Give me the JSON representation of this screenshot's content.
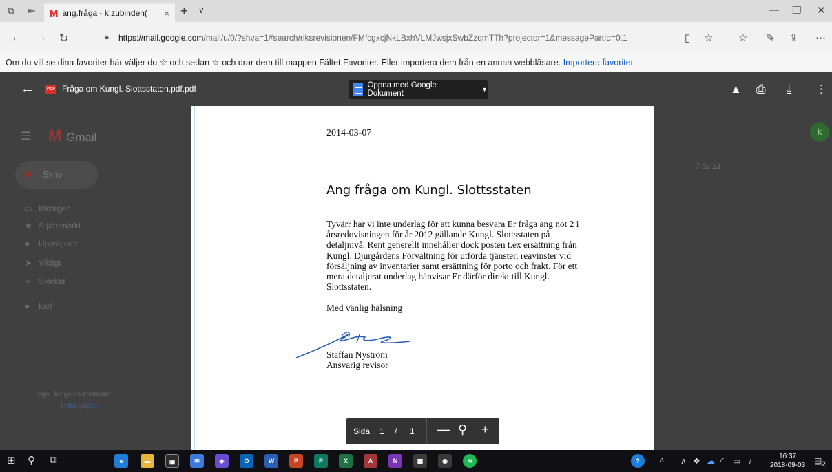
{
  "browser": {
    "tab_title": "ang.fråga - k.zubinden(",
    "tab_close": "×",
    "new_tab": "+",
    "tab_dropdown": "∨",
    "url_host": "https://mail.google.com",
    "url_path": "/mail/u/0/?shva=1#search/riksrevisionen/FMfcgxcjNkLBxhVLMJwsjxSwbZzqmTTh?projector=1&messagePartId=0.1",
    "favorites_message": "Om du vill se dina favoriter här väljer du ☆ och sedan ☆ och drar dem till mappen Fältet Favoriter. Eller importera dem från en annan webbläsare. ",
    "favorites_link": "Importera favoriter"
  },
  "gmail": {
    "logo_text": "Gmail",
    "compose_label": "Skriv",
    "nav_items": [
      {
        "label": "Inkorgen",
        "icon": "inbox-icon"
      },
      {
        "label": "Stjärnmärkt",
        "icon": "star-icon"
      },
      {
        "label": "Uppskjutet",
        "icon": "clock-icon"
      },
      {
        "label": "Viktigt",
        "icon": "important-icon"
      },
      {
        "label": "Skickat",
        "icon": "send-icon"
      }
    ],
    "user_label": "karl",
    "hangouts_note": "Inga Hangouts-kontakter",
    "hangouts_link": "Hitta någon",
    "avatar_letter": "k",
    "pager_text": "7 av 13"
  },
  "viewer": {
    "filename": "Fråga om Kungl. Slottsstaten.pdf.pdf",
    "pdf_badge": "PDF",
    "open_with_label": "Öppna med Google Dokument",
    "page_label": "Sida",
    "current_page": "1",
    "page_sep": "/",
    "total_pages": "1"
  },
  "document": {
    "date": "2014-03-07",
    "heading": "Ang fråga om Kungl. Slottsstaten",
    "body_lines": [
      "Tyvärr har vi inte underlag för att kunna besvara Er fråga ang not 2 i",
      "årsredovisningen för år 2012 gällande Kungl. Slottsstaten på",
      "detaljnivå. Rent generellt innehåller dock posten t.ex ersättning från",
      "Kungl. Djurgårdens Förvaltning för utförda tjänster, reavinster vid",
      "försäljning av inventarier samt ersättning för porto och frakt. För ett",
      "mera detaljerat underlag hänvisar Er därför direkt till Kungl.",
      "Slottsstaten."
    ],
    "greeting": "Med vänlig hälsning",
    "signer_name": "Staffan Nyström",
    "signer_title": "Ansvarig revisor"
  },
  "taskbar": {
    "time": "16:37",
    "date": "2018-09-03",
    "notification_count": "2"
  },
  "colors": {
    "gmail_red": "#d93025",
    "docs_blue": "#4285f4",
    "link_blue": "#0a59c4",
    "viewer_overlay": "#404040"
  }
}
